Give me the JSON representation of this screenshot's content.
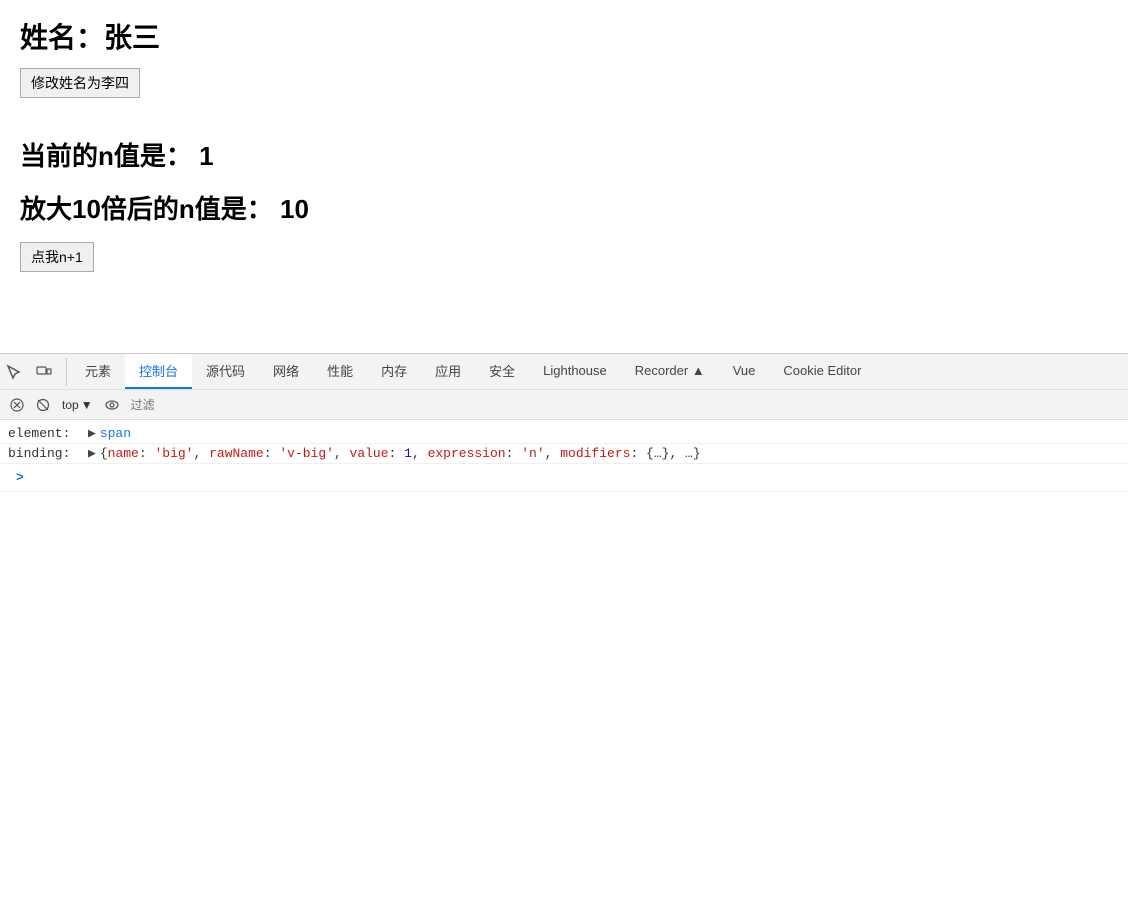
{
  "page": {
    "name_label": "姓名：张三",
    "modify_btn_label": "修改姓名为李四",
    "n_value_label": "当前的n值是：",
    "n_value": "1",
    "n_big_label": "放大10倍后的n值是：",
    "n_big_value": "10",
    "click_btn_label": "点我n+1"
  },
  "devtools": {
    "tabs": [
      {
        "id": "elements",
        "label": "元素",
        "active": false
      },
      {
        "id": "console",
        "label": "控制台",
        "active": true
      },
      {
        "id": "sources",
        "label": "源代码",
        "active": false
      },
      {
        "id": "network",
        "label": "网络",
        "active": false
      },
      {
        "id": "performance",
        "label": "性能",
        "active": false
      },
      {
        "id": "memory",
        "label": "内存",
        "active": false
      },
      {
        "id": "application",
        "label": "应用",
        "active": false
      },
      {
        "id": "security",
        "label": "安全",
        "active": false
      },
      {
        "id": "lighthouse",
        "label": "Lighthouse",
        "active": false
      },
      {
        "id": "recorder",
        "label": "Recorder ▲",
        "active": false
      },
      {
        "id": "vue",
        "label": "Vue",
        "active": false
      },
      {
        "id": "cookie-editor",
        "label": "Cookie Editor",
        "active": false
      }
    ],
    "secondary_toolbar": {
      "top_label": "top",
      "filter_placeholder": "过滤"
    },
    "console": {
      "rows": [
        {
          "key": "element:",
          "triangle": "▶",
          "value": "span",
          "type": "element"
        },
        {
          "key": "binding:",
          "triangle": "▶",
          "value": "{name: 'big', rawName: 'v-big', value: 1, expression: 'n', modifiers: {…}, …}",
          "type": "object"
        }
      ],
      "prompt": ">"
    }
  }
}
